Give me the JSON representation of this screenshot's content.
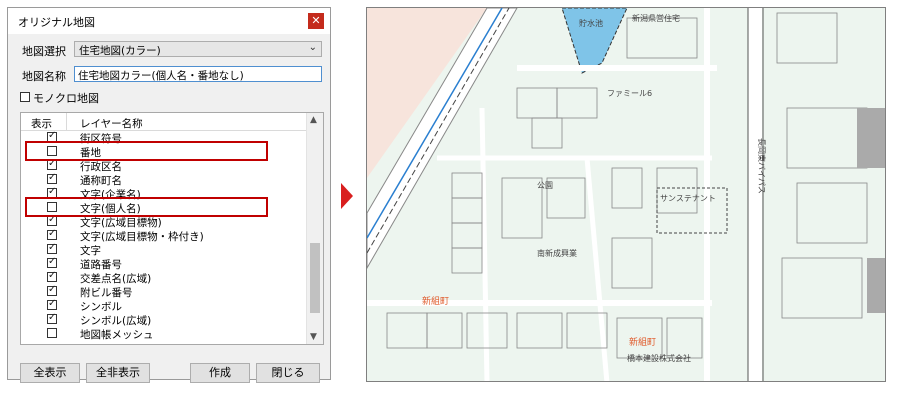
{
  "dialog": {
    "title": "オリジナル地図",
    "close_glyph": "✕",
    "map_select_label": "地図選択",
    "map_select_value": "住宅地図(カラー)",
    "map_name_label": "地図名称",
    "map_name_value": "住宅地図カラー(個人名・番地なし)",
    "monochrome_label": "モノクロ地図",
    "columns": {
      "show": "表示",
      "layer": "レイヤー名称"
    },
    "layers": [
      {
        "name": "街区符号",
        "checked": true
      },
      {
        "name": "番地",
        "checked": false
      },
      {
        "name": "行政区名",
        "checked": true
      },
      {
        "name": "通称町名",
        "checked": true
      },
      {
        "name": "文字(企業名)",
        "checked": true
      },
      {
        "name": "文字(個人名)",
        "checked": false
      },
      {
        "name": "文字(広域目標物)",
        "checked": true
      },
      {
        "name": "文字(広域目標物・枠付き)",
        "checked": true
      },
      {
        "name": "文字",
        "checked": true
      },
      {
        "name": "道路番号",
        "checked": true
      },
      {
        "name": "交差点名(広域)",
        "checked": true
      },
      {
        "name": "附ビル番号",
        "checked": true
      },
      {
        "name": "シンボル",
        "checked": true
      },
      {
        "name": "シンボル(広域)",
        "checked": true
      },
      {
        "name": "地図帳メッシュ",
        "checked": false
      }
    ],
    "buttons": {
      "show_all": "全表示",
      "hide_all": "全非表示",
      "create": "作成",
      "close": "閉じる"
    }
  },
  "map": {
    "labels": {
      "park": "公園",
      "famiry": "ファミール6",
      "shinsei": "南新成興業",
      "town1": "新組町",
      "town2": "新組町",
      "sunst": "サンステナント",
      "station": "橋本建設株式会社",
      "bypass": "長岡東バイパス",
      "pond": "貯水池",
      "doc": "新潟県営住宅"
    }
  },
  "colors": {
    "highlight": "#c00000",
    "arrow": "#d91f1f",
    "water": "#7fc4e8",
    "road": "#ffffff"
  }
}
